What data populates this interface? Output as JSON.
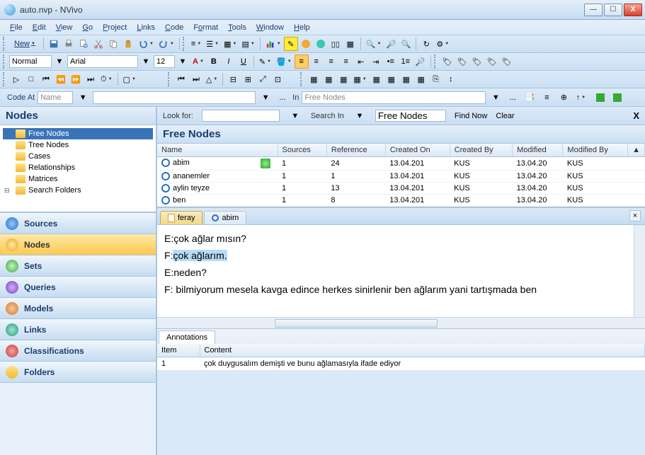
{
  "window": {
    "title": "auto.nvp - NVivo"
  },
  "menu": [
    "File",
    "Edit",
    "View",
    "Go",
    "Project",
    "Links",
    "Code",
    "Format",
    "Tools",
    "Window",
    "Help"
  ],
  "toolbar1": {
    "new": "New"
  },
  "format": {
    "style": "Normal",
    "font": "Arial",
    "size": "12"
  },
  "codebar": {
    "codeAt": "Code At",
    "name": "Name",
    "ellipsis": "...",
    "in": "In",
    "inValue": "Free Nodes"
  },
  "leftpanel": {
    "title": "Nodes",
    "tree": [
      {
        "label": "Free Nodes",
        "selected": true
      },
      {
        "label": "Tree Nodes"
      },
      {
        "label": "Cases"
      },
      {
        "label": "Relationships"
      },
      {
        "label": "Matrices"
      },
      {
        "label": "Search Folders",
        "exp": true
      }
    ],
    "nav": [
      {
        "label": "Sources",
        "icon": "ic-sources"
      },
      {
        "label": "Nodes",
        "icon": "ic-nodes",
        "active": true
      },
      {
        "label": "Sets",
        "icon": "ic-sets"
      },
      {
        "label": "Queries",
        "icon": "ic-queries"
      },
      {
        "label": "Models",
        "icon": "ic-models"
      },
      {
        "label": "Links",
        "icon": "ic-links"
      },
      {
        "label": "Classifications",
        "icon": "ic-class"
      },
      {
        "label": "Folders",
        "icon": "ic-folders"
      }
    ]
  },
  "search": {
    "lookFor": "Look for:",
    "searchIn": "Search In",
    "scope": "Free Nodes",
    "findNow": "Find Now",
    "clear": "Clear"
  },
  "list": {
    "title": "Free Nodes",
    "columns": [
      "Name",
      "Sources",
      "Reference",
      "Created On",
      "Created By",
      "Modified",
      "Modified By"
    ],
    "rows": [
      {
        "name": "abim",
        "hasUser": true,
        "sources": "1",
        "reference": "24",
        "createdOn": "13.04.201",
        "createdBy": "KUS",
        "modified": "13.04.20",
        "modifiedBy": "KUS"
      },
      {
        "name": "ananemler",
        "sources": "1",
        "reference": "1",
        "createdOn": "13.04.201",
        "createdBy": "KUS",
        "modified": "13.04.20",
        "modifiedBy": "KUS"
      },
      {
        "name": "aylin teyze",
        "sources": "1",
        "reference": "13",
        "createdOn": "13.04.201",
        "createdBy": "KUS",
        "modified": "13.04.20",
        "modifiedBy": "KUS"
      },
      {
        "name": "ben",
        "sources": "1",
        "reference": "8",
        "createdOn": "13.04.201",
        "createdBy": "KUS",
        "modified": "13.04.20",
        "modifiedBy": "KUS"
      }
    ]
  },
  "tabs": [
    {
      "label": "feray",
      "active": true,
      "kind": "doc"
    },
    {
      "label": "abim",
      "kind": "node"
    }
  ],
  "doc": {
    "lines": [
      {
        "text": "E:çok ağlar mısın?"
      },
      {
        "pre": "F:",
        "hl": "çok ağlarım.",
        "post": ""
      },
      {
        "text": "E:neden?"
      },
      {
        "text": "F: bilmiyorum mesela kavga edince herkes sinirlenir ben ağlarım yani tartışmada ben"
      }
    ]
  },
  "annotations": {
    "tab": "Annotations",
    "columns": [
      "Item",
      "Content"
    ],
    "rows": [
      {
        "item": "1",
        "content": "çok duygusalım demişti ve bunu ağlamasıyla ifade ediyor"
      }
    ]
  }
}
